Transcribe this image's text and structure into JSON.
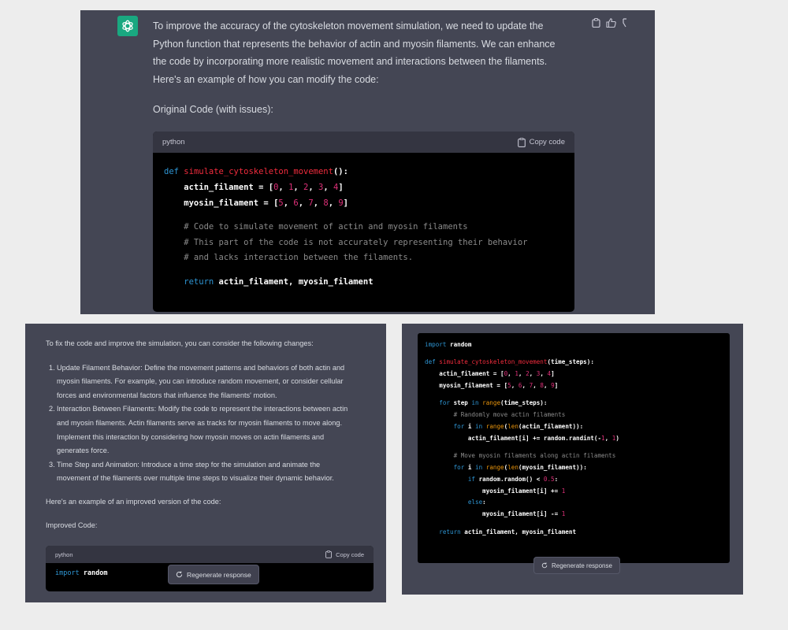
{
  "top": {
    "para": [
      "To improve the accuracy of the cytoskeleton movement simulation, we need to update the",
      "Python function that represents the behavior of actin and myosin filaments. We can enhance",
      "the code by incorporating more realistic movement and interactions between the filaments.",
      "Here's an example of how you can modify the code:"
    ],
    "original_label": "Original Code (with issues):",
    "code_lang": "python",
    "copy_label": "Copy code",
    "actions": [
      "clipboard-icon",
      "thumbs-up-icon",
      "thumbs-down-icon"
    ]
  },
  "left": {
    "intro": "To fix the code and improve the simulation, you can consider the following changes:",
    "items": [
      {
        "num": "1.",
        "lines": [
          "Update Filament Behavior: Define the movement patterns and behaviors of both actin and",
          "myosin filaments. For example, you can introduce random movement, or consider cellular",
          "forces and environmental factors that influence the filaments' motion."
        ]
      },
      {
        "num": "2.",
        "lines": [
          "Interaction Between Filaments: Modify the code to represent the interactions between actin",
          "and myosin filaments. Actin filaments serve as tracks for myosin filaments to move along.",
          "Implement this interaction by considering how myosin moves on actin filaments and",
          "generates force."
        ]
      },
      {
        "num": "3.",
        "lines": [
          "Time Step and Animation: Introduce a time step for the simulation and animate the",
          "movement of the filaments over multiple time steps to visualize their dynamic behavior."
        ]
      }
    ],
    "example": "Here's an example of an improved version of the code:",
    "improved_label": "Improved Code:",
    "code_lang": "python",
    "copy_label": "Copy code",
    "code_first_kw": "import",
    "code_first_rest": " random",
    "regen_label": "Regenerate response"
  },
  "right": {
    "regen_label": "Regenerate response"
  },
  "code_top": [
    [
      [
        "kw",
        "def "
      ],
      [
        "fn",
        "simulate_cytoskeleton_movement"
      ],
      [
        "bold",
        "():"
      ]
    ],
    [
      [
        "bold",
        "    actin_filament = ["
      ],
      [
        "num",
        "0"
      ],
      [
        "bold",
        ", "
      ],
      [
        "num",
        "1"
      ],
      [
        "bold",
        ", "
      ],
      [
        "num",
        "2"
      ],
      [
        "bold",
        ", "
      ],
      [
        "num",
        "3"
      ],
      [
        "bold",
        ", "
      ],
      [
        "num",
        "4"
      ],
      [
        "bold",
        "]"
      ]
    ],
    [
      [
        "bold",
        "    myosin_filament = ["
      ],
      [
        "num",
        "5"
      ],
      [
        "bold",
        ", "
      ],
      [
        "num",
        "6"
      ],
      [
        "bold",
        ", "
      ],
      [
        "num",
        "7"
      ],
      [
        "bold",
        ", "
      ],
      [
        "num",
        "8"
      ],
      [
        "bold",
        ", "
      ],
      [
        "num",
        "9"
      ],
      [
        "bold",
        "]"
      ]
    ],
    [
      [
        "",
        ""
      ]
    ],
    [
      [
        "cm",
        "    # Code to simulate movement of actin and myosin filaments"
      ]
    ],
    [
      [
        "cm",
        "    # This part of the code is not accurately representing their behavior"
      ]
    ],
    [
      [
        "cm",
        "    # and lacks interaction between the filaments."
      ]
    ],
    [
      [
        "",
        ""
      ]
    ],
    [
      [
        "kw",
        "    return "
      ],
      [
        "bold",
        "actin_filament, myosin_filament"
      ]
    ]
  ],
  "code_right": [
    [
      [
        "kw",
        "import "
      ],
      [
        "bold",
        "random"
      ]
    ],
    [
      [
        "",
        ""
      ]
    ],
    [
      [
        "kw",
        "def "
      ],
      [
        "fn",
        "simulate_cytoskeleton_movement"
      ],
      [
        "bold",
        "(time_steps):"
      ]
    ],
    [
      [
        "bold",
        "    actin_filament = ["
      ],
      [
        "num",
        "0"
      ],
      [
        "bold",
        ", "
      ],
      [
        "num",
        "1"
      ],
      [
        "bold",
        ", "
      ],
      [
        "num",
        "2"
      ],
      [
        "bold",
        ", "
      ],
      [
        "num",
        "3"
      ],
      [
        "bold",
        ", "
      ],
      [
        "num",
        "4"
      ],
      [
        "bold",
        "]"
      ]
    ],
    [
      [
        "bold",
        "    myosin_filament = ["
      ],
      [
        "num",
        "5"
      ],
      [
        "bold",
        ", "
      ],
      [
        "num",
        "6"
      ],
      [
        "bold",
        ", "
      ],
      [
        "num",
        "7"
      ],
      [
        "bold",
        ", "
      ],
      [
        "num",
        "8"
      ],
      [
        "bold",
        ", "
      ],
      [
        "num",
        "9"
      ],
      [
        "bold",
        "]"
      ]
    ],
    [
      [
        "",
        ""
      ]
    ],
    [
      [
        "kw",
        "    for "
      ],
      [
        "bold",
        "step "
      ],
      [
        "kw",
        "in "
      ],
      [
        "bi",
        "range"
      ],
      [
        "bold",
        "(time_steps):"
      ]
    ],
    [
      [
        "cm",
        "        # Randomly move actin filaments"
      ]
    ],
    [
      [
        "kw",
        "        for "
      ],
      [
        "bold",
        "i "
      ],
      [
        "kw",
        "in "
      ],
      [
        "bi",
        "range"
      ],
      [
        "bold",
        "("
      ],
      [
        "bi",
        "len"
      ],
      [
        "bold",
        "(actin_filament)):"
      ]
    ],
    [
      [
        "bold",
        "            actin_filament[i] += random.randint(-"
      ],
      [
        "num",
        "1"
      ],
      [
        "bold",
        ", "
      ],
      [
        "num",
        "1"
      ],
      [
        "bold",
        ")"
      ]
    ],
    [
      [
        "",
        ""
      ]
    ],
    [
      [
        "cm",
        "        # Move myosin filaments along actin filaments"
      ]
    ],
    [
      [
        "kw",
        "        for "
      ],
      [
        "bold",
        "i "
      ],
      [
        "kw",
        "in "
      ],
      [
        "bi",
        "range"
      ],
      [
        "bold",
        "("
      ],
      [
        "bi",
        "len"
      ],
      [
        "bold",
        "(myosin_filament)):"
      ]
    ],
    [
      [
        "kw",
        "            if "
      ],
      [
        "bold",
        "random.random() < "
      ],
      [
        "num",
        "0.5"
      ],
      [
        "bold",
        ":"
      ]
    ],
    [
      [
        "bold",
        "                myosin_filament[i] += "
      ],
      [
        "num",
        "1"
      ]
    ],
    [
      [
        "kw",
        "            else"
      ],
      [
        "bold",
        ":"
      ]
    ],
    [
      [
        "bold",
        "                myosin_filament[i] -= "
      ],
      [
        "num",
        "1"
      ]
    ],
    [
      [
        "",
        ""
      ]
    ],
    [
      [
        "kw",
        "    return "
      ],
      [
        "bold",
        "actin_filament, myosin_filament"
      ]
    ]
  ]
}
